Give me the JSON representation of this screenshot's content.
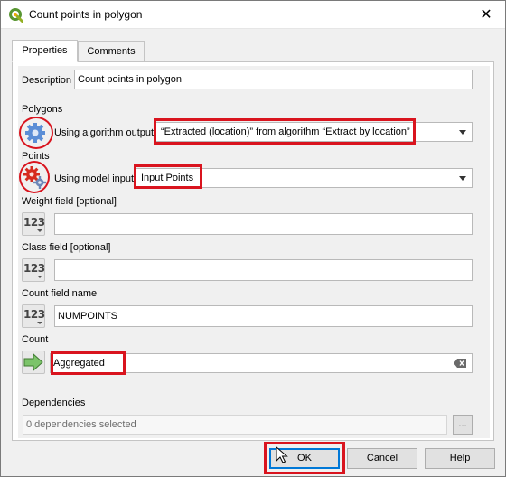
{
  "window": {
    "title": "Count points in polygon",
    "close_glyph": "✕",
    "logo_icon": "qgis-logo-icon"
  },
  "tabs": [
    {
      "label": "Properties",
      "active": true
    },
    {
      "label": "Comments",
      "active": false
    }
  ],
  "description": {
    "label": "Description",
    "value": "Count points in polygon"
  },
  "polygons": {
    "label": "Polygons",
    "source_icon": "model-output-gear-icon",
    "source_label": "Using algorithm output",
    "value": "“Extracted (location)” from algorithm “Extract by location”"
  },
  "points": {
    "label": "Points",
    "source_icon": "model-input-gears-icon",
    "source_label": "Using model input",
    "value": "Input Points"
  },
  "weight_field": {
    "label": "Weight field [optional]",
    "icon_text": "123",
    "value": ""
  },
  "class_field": {
    "label": "Class field [optional]",
    "icon_text": "123",
    "value": ""
  },
  "count_field_name": {
    "label": "Count field name",
    "icon_text": "123",
    "value": "NUMPOINTS"
  },
  "count": {
    "label": "Count",
    "source_icon": "output-arrow-icon",
    "value": "Aggregated",
    "clear_icon": "clear-text-icon"
  },
  "dependencies": {
    "label": "Dependencies",
    "value": "0 dependencies selected",
    "browse_label": "..."
  },
  "buttons": {
    "ok": "OK",
    "cancel": "Cancel",
    "help": "Help"
  },
  "colors": {
    "highlight": "#d9141e",
    "accent": "#0078d7"
  }
}
